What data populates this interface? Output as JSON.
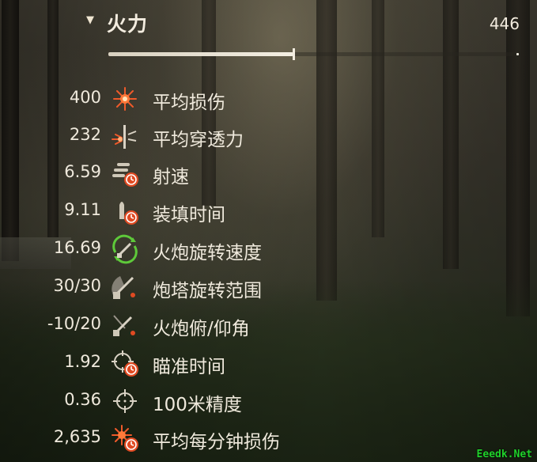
{
  "header": {
    "title": "火力",
    "total": "446",
    "progress_fraction": 0.45
  },
  "stats": [
    {
      "value": "400",
      "label": "平均损伤",
      "icon": "damage-burst-icon"
    },
    {
      "value": "232",
      "label": "平均穿透力",
      "icon": "penetration-icon"
    },
    {
      "value": "6.59",
      "label": "射速",
      "icon": "rate-of-fire-icon"
    },
    {
      "value": "9.11",
      "label": "装填时间",
      "icon": "reload-shell-icon"
    },
    {
      "value": "16.69",
      "label": "火炮旋转速度",
      "icon": "gun-traverse-speed-icon"
    },
    {
      "value": "30/30",
      "label": "炮塔旋转范围",
      "icon": "turret-traverse-arc-icon"
    },
    {
      "value": "-10/20",
      "label": "火炮俯/仰角",
      "icon": "gun-elevation-icon"
    },
    {
      "value": "1.92",
      "label": "瞄准时间",
      "icon": "aim-time-icon"
    },
    {
      "value": "0.36",
      "label": "100米精度",
      "icon": "crosshair-icon"
    },
    {
      "value": "2,635",
      "label": "平均每分钟损伤",
      "icon": "damage-per-minute-icon"
    }
  ],
  "watermark": "Eeedk.Net",
  "colors": {
    "accent_orange": "#e8562a",
    "text": "#efe9dc",
    "green_arrow": "#5ec93a"
  }
}
